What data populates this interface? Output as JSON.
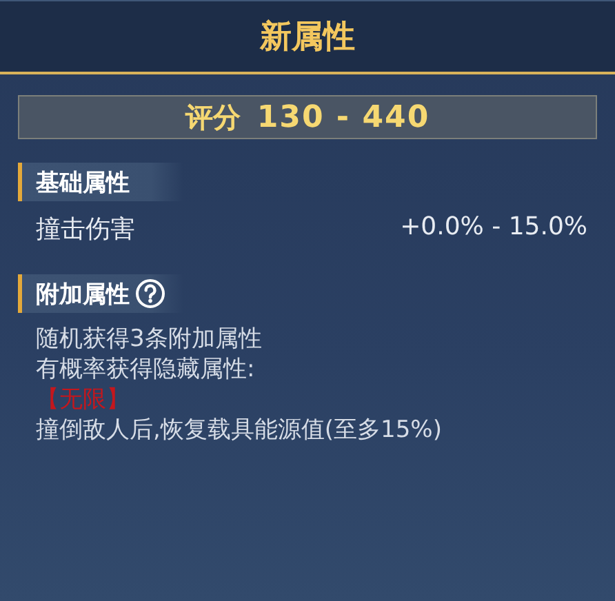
{
  "title": "新属性",
  "score": {
    "label": "评分",
    "range": "130 - 440"
  },
  "sections": [
    {
      "heading": "基础属性",
      "help": false,
      "stats": [
        {
          "name": "撞击伤害",
          "value": "+0.0% - 15.0%"
        }
      ]
    },
    {
      "heading": "附加属性",
      "help": true,
      "lines": [
        {
          "kind": "text",
          "text": "随机获得3条附加属性"
        },
        {
          "kind": "text",
          "text": "有概率获得隐藏属性:"
        },
        {
          "kind": "tag",
          "text": "【无限】"
        },
        {
          "kind": "text",
          "text": "撞倒敌人后,恢复载具能源值(至多15%)"
        }
      ]
    }
  ]
}
